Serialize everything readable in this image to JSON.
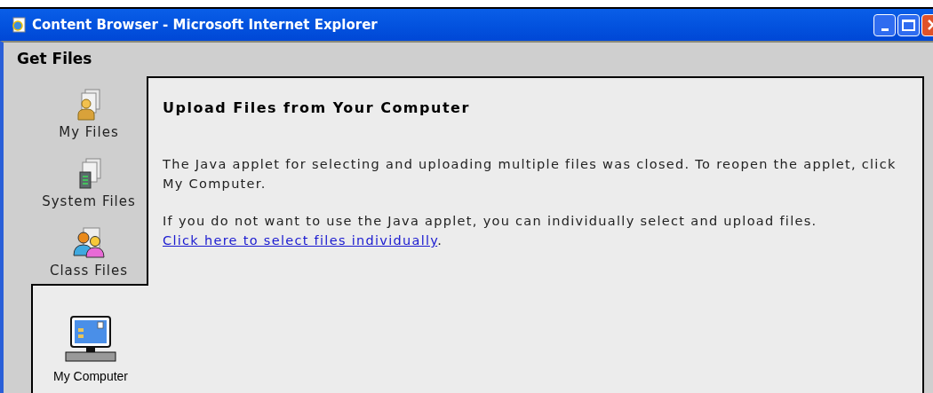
{
  "window": {
    "title": "Content Browser - Microsoft Internet Explorer"
  },
  "header": "Get Files",
  "tabs": [
    {
      "label": "My Files",
      "kind": "user",
      "selected": false
    },
    {
      "label": "System Files",
      "kind": "system",
      "selected": false
    },
    {
      "label": "Class Files",
      "kind": "class",
      "selected": false
    },
    {
      "label": "My Computer",
      "kind": "computer",
      "selected": true
    }
  ],
  "panel": {
    "title": "Upload Files from Your Computer",
    "paragraphs": [
      {
        "text": "The Java applet for selecting and uploading multiple files was closed. To reopen the applet, click My Computer."
      },
      {
        "text": "If you do not want to use the Java applet, you can individually select and upload files.",
        "link": "Click here to select files individually",
        "after": "."
      }
    ]
  }
}
